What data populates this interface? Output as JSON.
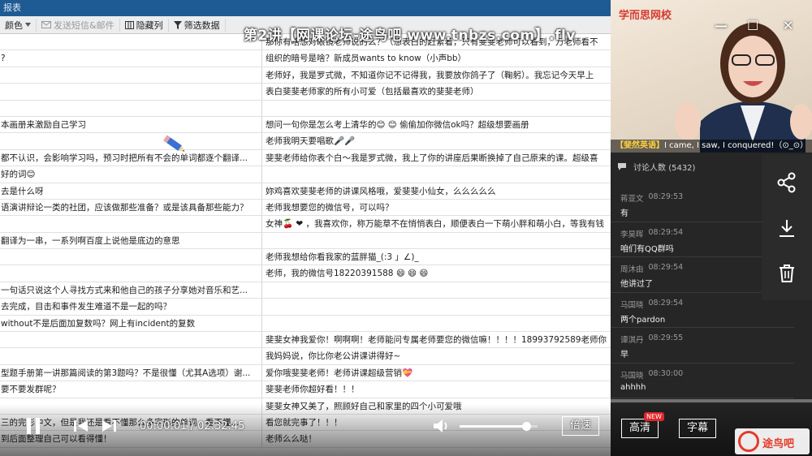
{
  "sheet": {
    "title": "报表",
    "toolbar": [
      {
        "label": "颜色",
        "icon": "dropdown-icon",
        "dim": false
      },
      {
        "label": "发送短信&邮件",
        "icon": "mail-icon",
        "dim": true
      },
      {
        "label": "隐藏列",
        "icon": "hide-columns-icon",
        "dim": false
      },
      {
        "label": "筛选数据",
        "icon": "filter-icon",
        "dim": false
      }
    ],
    "rows": [
      {
        "q": "",
        "a": "那你有啥想对眼镜老师说的么？（想表白的赶紧着，只有斐斐老师可以看到，万老师看不"
      },
      {
        "q": "?",
        "a": "组织的暗号是啥？新成员wants to know（小声bb）"
      },
      {
        "q": "",
        "a": "老师好，我是罗式微，不知道你记不记得我，我要放你鸽子了（鞠躬）。我忘记今天早上"
      },
      {
        "q": "",
        "a": "表白斐斐老师家的所有小可爱（包括最喜欢的斐斐老师）"
      },
      {
        "q": "",
        "a": ""
      },
      {
        "q": "本画册来激励自己学习",
        "a": "想问一句你是怎么考上清华的😊 😊 偷偷加你微信ok吗？超级想要画册"
      },
      {
        "q": "",
        "a": "老师我明天要唱歌🎤🎤"
      },
      {
        "q": "都不认识，会影响学习吗，预习时把所有不会的单词都逐个翻译...",
        "a": "斐斐老师给你表个白～我是罗式微，我上了你的讲座后果断换掉了自己原来的课。超级喜"
      },
      {
        "q": "好的词😊",
        "a": ""
      },
      {
        "q": "去是什么呀",
        "a": "妳鸡喜欢斐斐老师的讲课风格哦，爱斐斐小仙女，么么么么么"
      },
      {
        "q": "语演讲辩论一类的社团，应该做那些准备？或是该具备那些能力？",
        "a": "老师我想要您的微信号，可以吗？"
      },
      {
        "q": "",
        "a": "女神🍒 ❤ ，我喜欢你，称万能草不在悄悄表白，顺便表白一下萌小胖和萌小白，等我有钱"
      },
      {
        "q": "翻译为一串，一系列啊百度上说他是底边的意思",
        "a": ""
      },
      {
        "q": "",
        "a": "老师我想给你看我家的蓝胖猫_(:3 」∠)_"
      },
      {
        "q": "",
        "a": "老师，我的微信号18220391588 😄 😄 😄"
      },
      {
        "q": "一句话只说这个人寻找方式来和他自己的孩子分享她对音乐和艺...",
        "a": ""
      },
      {
        "q": "去完成，目击和事件发生难道不是一起的吗？",
        "a": ""
      },
      {
        "q": "without不是后面加复数吗？网上有incident的复数",
        "a": ""
      },
      {
        "q": "",
        "a": "斐斐女神我爱你！啊啊啊！老师能问专属老师要您的微信嘛！！！！18993792589老师你"
      },
      {
        "q": "",
        "a": "我妈妈说，你比你老公讲课讲得好~"
      },
      {
        "q": "型题手册第一讲那篇阅读的第3题吗？不是很懂（尤其A选项）谢...",
        "a": "爱你哦斐斐老师！老师讲课超级营销💝"
      },
      {
        "q": "要不要发群呢？",
        "a": "斐斐老师你超好看！！！"
      },
      {
        "q": "",
        "a": "斐斐女神又美了，照顾好自己和家里的四个小可爱哦"
      },
      {
        "q": "三的完形中文，但是我还是看不懂那么多字形的单词，看不懂...",
        "a": "看您就完事了！！！"
      },
      {
        "q": "到后面整理自己可以看得懂！",
        "a": "老师么么哒！"
      }
    ]
  },
  "video": {
    "title": "第2讲【网课论坛-途鸟吧 www.tnbzs.com】.flv",
    "current_time": "00:00:01",
    "duration": "02:32:45",
    "time_separator": "/",
    "progress": 0.001,
    "volume": 0.85,
    "speed_label": "倍速",
    "quality_label": "高清",
    "new_badge": "NEW",
    "subtitle_label": "字幕"
  },
  "panel": {
    "logo": "学而思网校",
    "caption_name": "【斐然英语】",
    "caption_text": "I came, I saw, I conquered!（⊙_⊙）",
    "discussion_label": "讨论人数",
    "discussion_count": "(5432)",
    "messages": [
      {
        "user": "蒋亚文",
        "time": "08:29:53",
        "text": "有"
      },
      {
        "user": "李昊晖",
        "time": "08:29:54",
        "text": "咱们有QQ群吗"
      },
      {
        "user": "周沐由",
        "time": "08:29:54",
        "text": "他讲过了"
      },
      {
        "user": "马国晓",
        "time": "08:29:54",
        "text": "两个pardon"
      },
      {
        "user": "谭淇丹",
        "time": "08:29:55",
        "text": "早"
      },
      {
        "user": "马国晓",
        "time": "08:30:00",
        "text": "ahhhh"
      }
    ],
    "watermark": "途鸟吧"
  },
  "colors": {
    "sheet_title_bg": "#1e5a93",
    "panel_bg": "#262626",
    "logo_red": "#d63a2f",
    "badge_red": "#e0252c"
  }
}
